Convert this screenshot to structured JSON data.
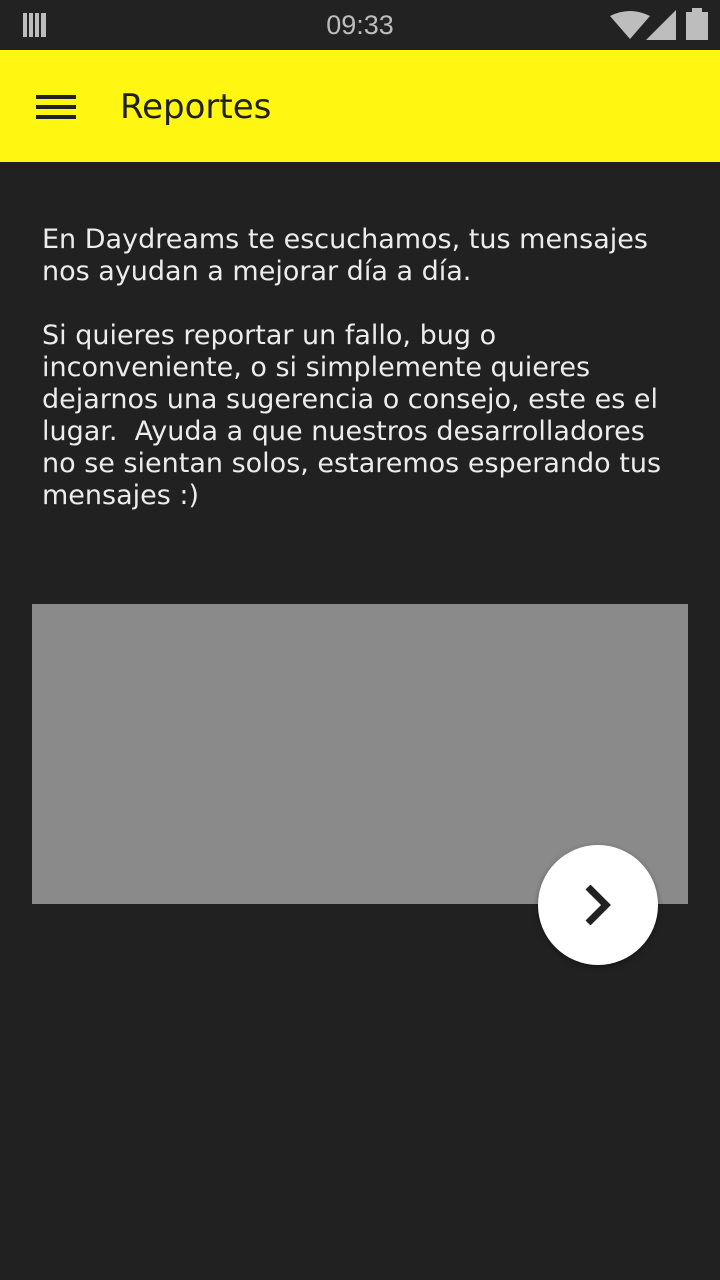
{
  "status_bar": {
    "time": "09:33",
    "icons": [
      "notification-stack-icon",
      "wifi-icon",
      "signal-icon",
      "battery-icon"
    ]
  },
  "app_bar": {
    "menu_icon": "menu-icon",
    "title": "Reportes",
    "background_color": "#fff611"
  },
  "content": {
    "intro_text": "En Daydreams te escuchamos, tus mensajes\nnos ayudan a mejorar día a día.\n\nSi quieres reportar un fallo, bug o\ninconveniente, o si simplemente quieres\ndejarnos una sugerencia o consejo, este es el\nlugar.  Ayuda a que nuestros desarrolladores\nno se sientan solos, estaremos esperando tus\nmensajes :)",
    "message_input_value": "",
    "message_input_color": "#8a8a8a"
  },
  "send_button": {
    "icon": "chevron-right-icon"
  },
  "colors": {
    "background": "#212121",
    "accent": "#fff611",
    "text": "#ececec"
  }
}
